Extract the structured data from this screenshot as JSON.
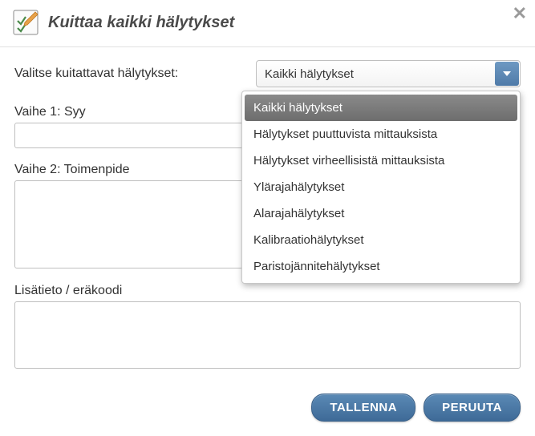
{
  "header": {
    "title": "Kuittaa kaikki hälytykset"
  },
  "form": {
    "select_label": "Valitse kuitattavat hälytykset:",
    "select_value": "Kaikki hälytykset",
    "options": [
      "Kaikki hälytykset",
      "Hälytykset puuttuvista mittauksista",
      "Hälytykset virheellisistä mittauksista",
      "Ylärajahälytykset",
      "Alarajahälytykset",
      "Kalibraatiohälytykset",
      "Paristojännitehälytykset"
    ],
    "selected_index": 0,
    "field1_label": "Vaihe 1: Syy",
    "field1_value": "",
    "field2_label": "Vaihe 2: Toimenpide",
    "field2_value": "",
    "field3_label": "Lisätieto / eräkoodi",
    "field3_value": ""
  },
  "buttons": {
    "save": "TALLENNA",
    "cancel": "PERUUTA"
  }
}
